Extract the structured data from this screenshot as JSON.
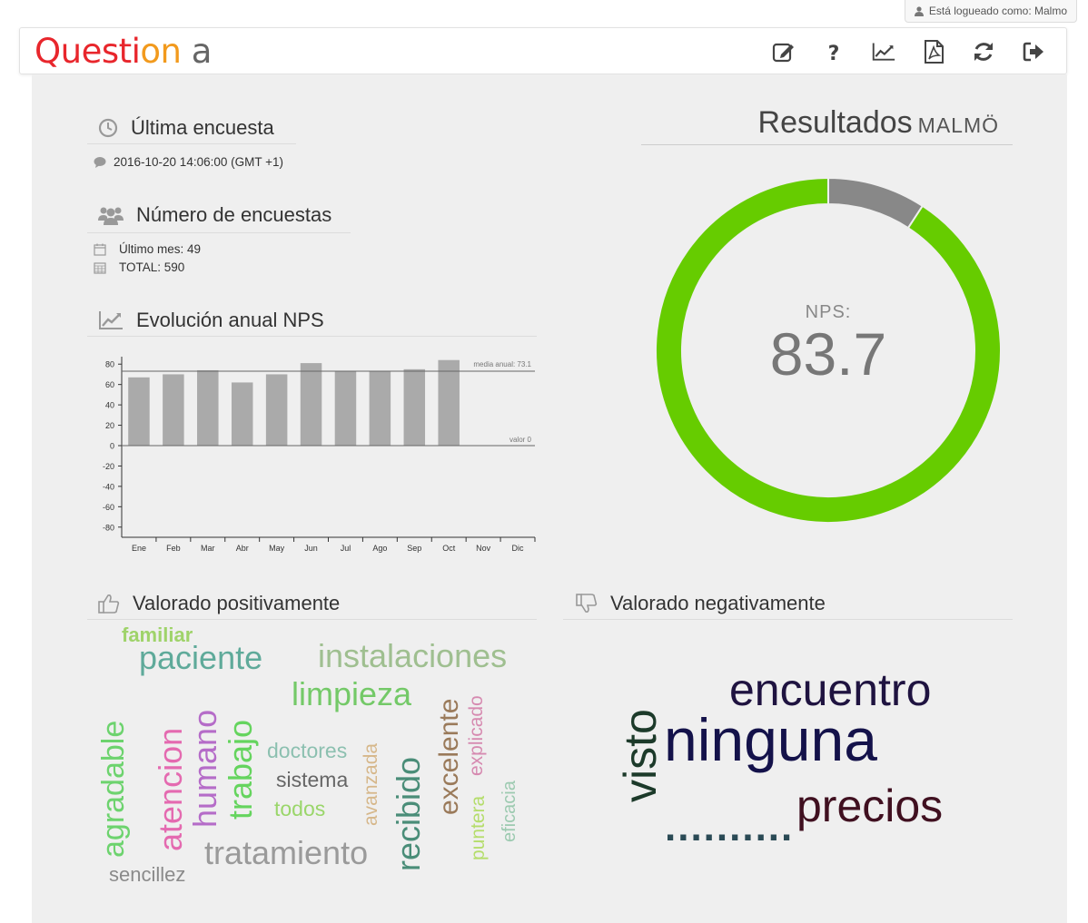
{
  "header": {
    "login_text": "Está logueado como: Malmo",
    "logo": {
      "q": "Q",
      "uest": "uesti",
      "on": "on",
      "a": " a"
    },
    "icons": [
      "edit-icon",
      "help-icon",
      "chart-line-icon",
      "pdf-icon",
      "refresh-icon",
      "logout-icon"
    ]
  },
  "ultima": {
    "title": "Última encuesta",
    "date": "2016-10-20 14:06:00 (GMT +1)"
  },
  "numero": {
    "title": "Número de encuestas",
    "last_month": "Último mes: 49",
    "total": "TOTAL: 590"
  },
  "evolucion": {
    "title": "Evolución anual NPS"
  },
  "resultados": {
    "title": "Resultados",
    "city": "MALMÖ",
    "nps_label": "NPS:",
    "nps_value": "83.7"
  },
  "donut_data": {
    "type": "pie",
    "segments": [
      {
        "name": "gray",
        "value": 9.2,
        "color": "#888888"
      },
      {
        "name": "green",
        "value": 90.8,
        "color": "#66cc00"
      }
    ]
  },
  "chart_data": {
    "type": "bar",
    "categories": [
      "Ene",
      "Feb",
      "Mar",
      "Abr",
      "May",
      "Jun",
      "Jul",
      "Ago",
      "Sep",
      "Oct",
      "Nov",
      "Dic"
    ],
    "values": [
      67,
      70,
      74,
      62,
      70,
      81,
      73,
      73,
      75,
      84,
      null,
      null
    ],
    "ylim": [
      -90,
      90
    ],
    "yticks": [
      80,
      60,
      40,
      20,
      0,
      -20,
      -40,
      -60,
      -80
    ],
    "mean": 73.1,
    "mean_label": "media anual: 73.1",
    "zero_label": "valor 0",
    "bar_color": "#aaaaaa"
  },
  "positivo": {
    "title": "Valorado positivamente",
    "words": [
      {
        "text": "familiar",
        "color": "#9fd36a"
      },
      {
        "text": "paciente",
        "color": "#5faa9a"
      },
      {
        "text": "instalaciones",
        "color": "#9fbf90"
      },
      {
        "text": "limpieza",
        "color": "#74c968"
      },
      {
        "text": "agradable",
        "color": "#6dd36e"
      },
      {
        "text": "atencion",
        "color": "#e46ab0"
      },
      {
        "text": "humano",
        "color": "#b56cc8"
      },
      {
        "text": "trabajo",
        "color": "#65d45e"
      },
      {
        "text": "doctores",
        "color": "#8cc0b0"
      },
      {
        "text": "sistema",
        "color": "#666666"
      },
      {
        "text": "todos",
        "color": "#9ad66a"
      },
      {
        "text": "avanzada",
        "color": "#d6b78a"
      },
      {
        "text": "recibido",
        "color": "#4a8d78"
      },
      {
        "text": "excelente",
        "color": "#9a7a5a"
      },
      {
        "text": "explicado",
        "color": "#d68ab0"
      },
      {
        "text": "puntera",
        "color": "#b4dd6a"
      },
      {
        "text": "eficacia",
        "color": "#9ccab0"
      },
      {
        "text": "tratamiento",
        "color": "#9a9a9a"
      },
      {
        "text": "sencillez",
        "color": "#8a8a8a"
      }
    ]
  },
  "negativo": {
    "title": "Valorado negativamente",
    "words": [
      {
        "text": "encuentro",
        "color": "#1f1340"
      },
      {
        "text": "ninguna",
        "color": "#14124a"
      },
      {
        "text": "visto",
        "color": "#1c3a2a"
      },
      {
        "text": "precios",
        "color": "#401020"
      },
      {
        "text": "..........",
        "color": "#2a4a55"
      }
    ]
  }
}
